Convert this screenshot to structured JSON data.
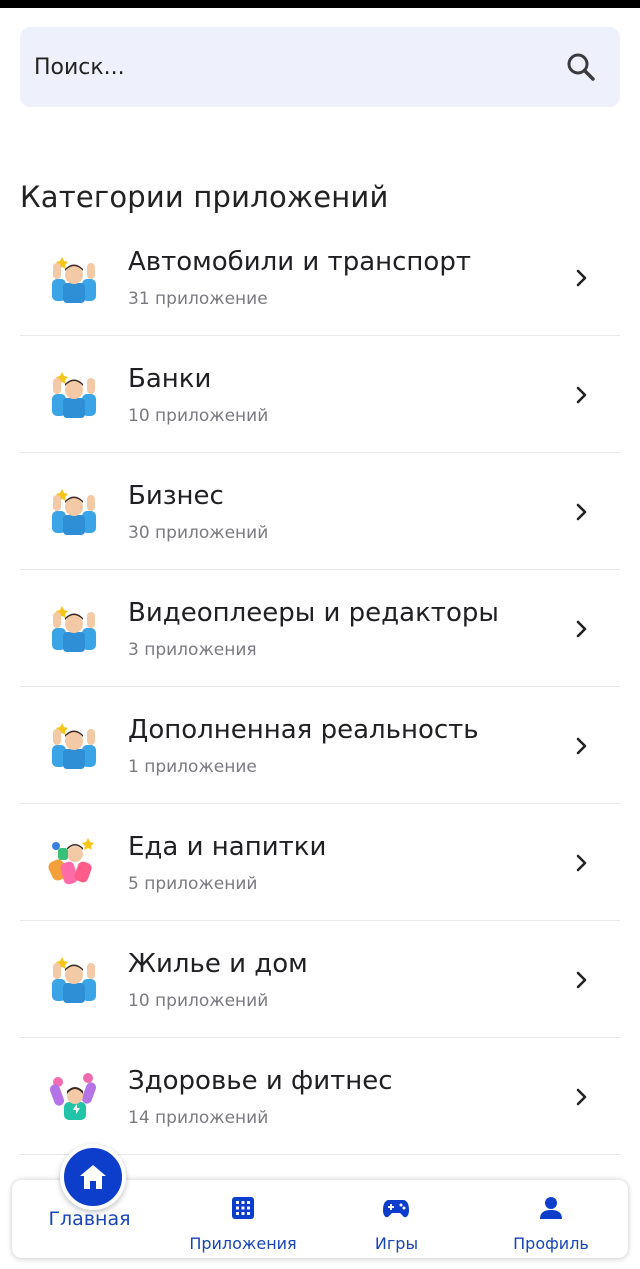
{
  "search": {
    "placeholder": "Поиск..."
  },
  "section_title": "Категории приложений",
  "categories": [
    {
      "title": "Автомобили и транспорт",
      "count": "31 приложение",
      "icon": "person-celebrating-icon"
    },
    {
      "title": "Банки",
      "count": "10 приложений",
      "icon": "person-celebrating-icon"
    },
    {
      "title": "Бизнес",
      "count": "30 приложений",
      "icon": "person-celebrating-icon"
    },
    {
      "title": "Видеоплееры и редакторы",
      "count": "3 приложения",
      "icon": "person-celebrating-icon"
    },
    {
      "title": "Дополненная реальность",
      "count": "1 приложение",
      "icon": "person-celebrating-icon"
    },
    {
      "title": "Еда и напитки",
      "count": "5 приложений",
      "icon": "person-food-icon"
    },
    {
      "title": "Жилье и дом",
      "count": "10 приложений",
      "icon": "person-celebrating-icon"
    },
    {
      "title": "Здоровье и фитнес",
      "count": "14 приложений",
      "icon": "person-fitness-icon"
    }
  ],
  "nav": {
    "home": "Главная",
    "apps": "Приложения",
    "games": "Игры",
    "profile": "Профиль"
  },
  "colors": {
    "accent": "#0d3ecb",
    "nav_text": "#1846b8",
    "search_bg": "#eef1fb"
  }
}
